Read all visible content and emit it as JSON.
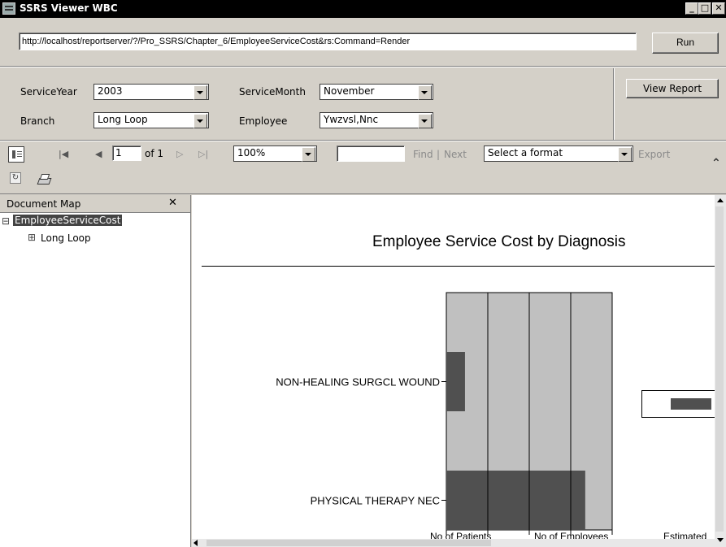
{
  "window": {
    "title": "SSRS Viewer WBC",
    "minimize": "_",
    "maximize": "□",
    "close": "✕"
  },
  "url_bar": {
    "value": "http://localhost/reportserver/?/Pro_SSRS/Chapter_6/EmployeeServiceCost&rs:Command=Render",
    "run_label": "Run"
  },
  "params": {
    "service_year_label": "ServiceYear",
    "service_year_value": "2003",
    "service_month_label": "ServiceMonth",
    "service_month_value": "November",
    "branch_label": "Branch",
    "branch_value": "Long Loop",
    "employee_label": "Employee",
    "employee_value": "Ywzvsl,Nnc",
    "view_report_label": "View Report"
  },
  "toolbar": {
    "page_value": "1",
    "of_text": "of 1",
    "zoom_value": "100%",
    "search_value": "",
    "find_label": "Find",
    "separator": "|",
    "next_label": "Next",
    "format_value": "Select a format",
    "export_label": "Export"
  },
  "doc_map": {
    "title": "Document Map",
    "close": "✕",
    "root": "EmployeeServiceCost",
    "child": "Long Loop",
    "collapse_glyph": "⊟",
    "expand_glyph": "⊞"
  },
  "report": {
    "title": "Employee Service Cost by Diagnosis",
    "column_headers": [
      "No of Patients",
      "No of Employees",
      "Estimated"
    ]
  },
  "chart_data": {
    "type": "bar",
    "orientation": "horizontal",
    "categories": [
      "NON-HEALING SURGCL WOUND",
      "PHYSICAL THERAPY NEC"
    ],
    "values": [
      9,
      67
    ],
    "xlim": [
      0,
      80
    ],
    "xticks": [
      "0",
      "20",
      "40",
      "60",
      "80"
    ],
    "grid": true,
    "colors": {
      "bar": "#505050",
      "plot_background": "#c0c0c0"
    }
  }
}
